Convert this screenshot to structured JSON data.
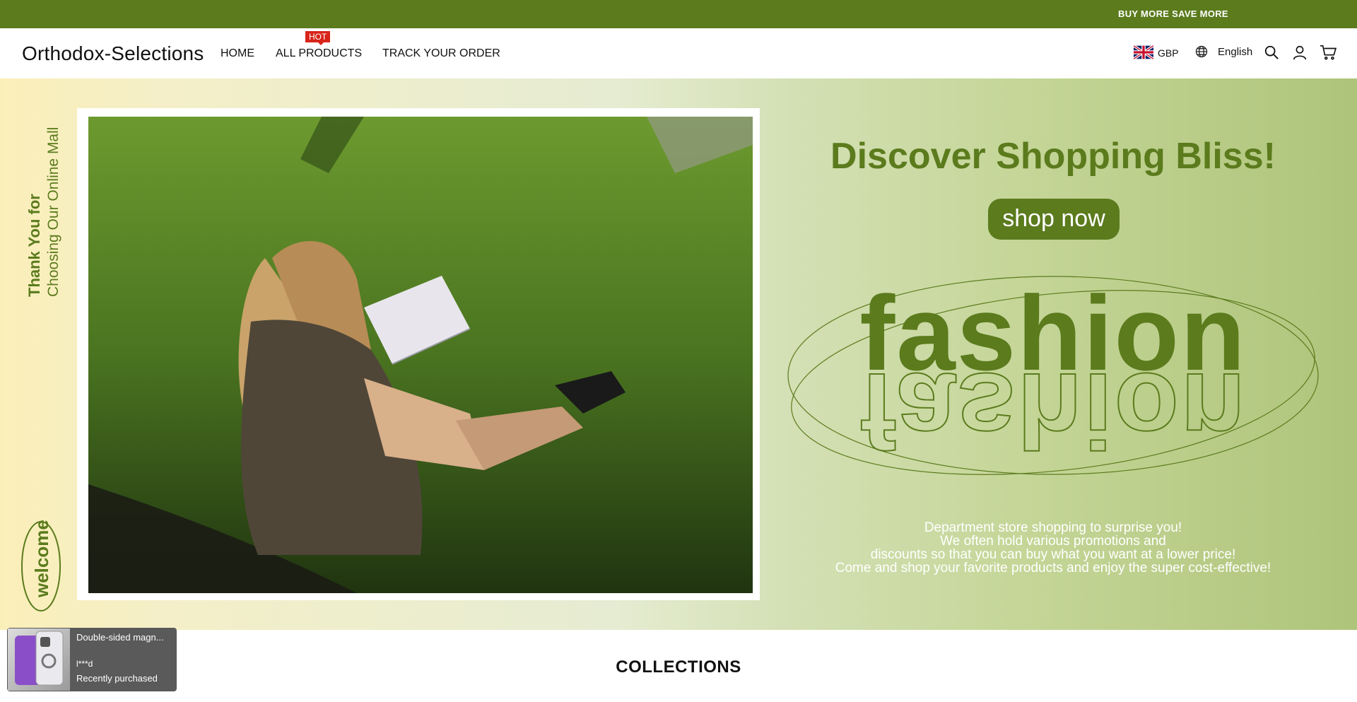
{
  "announcement": {
    "text": "BUY MORE SAVE MORE"
  },
  "header": {
    "logo": "Orthodox-Selections",
    "nav": [
      {
        "label": "HOME"
      },
      {
        "label": "ALL PRODUCTS",
        "badge": "HOT"
      },
      {
        "label": "TRACK YOUR ORDER"
      }
    ],
    "currency": "GBP",
    "language": "English",
    "icons": [
      "search-icon",
      "user-icon",
      "cart-icon"
    ]
  },
  "hero": {
    "side_text_1": "Thank You for",
    "side_text_2": "Choosing Our Online Mall",
    "side_badge": "welcome",
    "headline": "Discover Shopping Bliss!",
    "cta": "shop now",
    "big_word": "fashion",
    "description": [
      "Department store shopping to surprise you!",
      "We often hold various promotions and",
      "discounts so that you can buy what you want at a lower price!",
      "Come and shop your favorite products and enjoy the super cost-effective!"
    ]
  },
  "section": {
    "title": "COLLECTIONS"
  },
  "toast": {
    "product": "Double-sided magn...",
    "buyer": "l***d",
    "status": "Recently purchased"
  },
  "colors": {
    "brand": "#5b7b1d",
    "badge": "#d8241a"
  }
}
